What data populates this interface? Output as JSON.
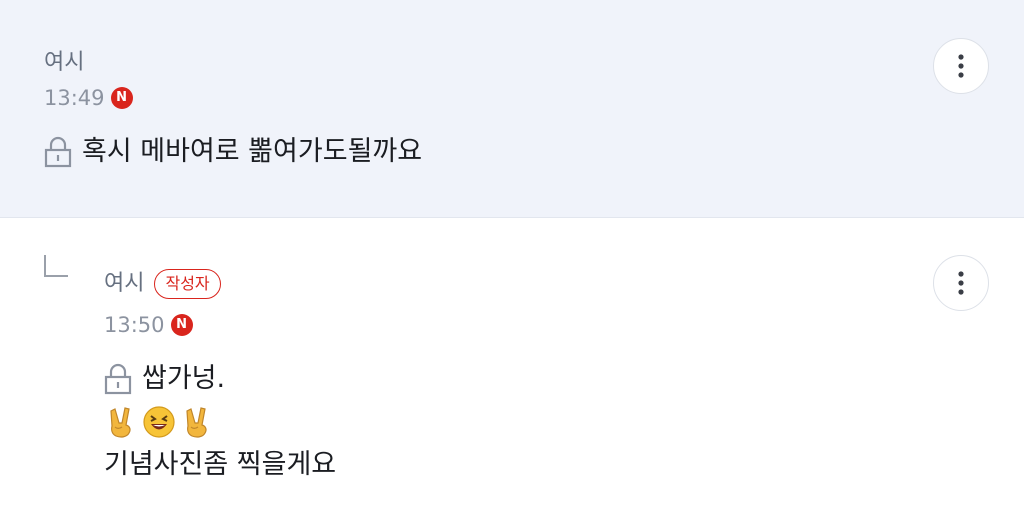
{
  "comments": [
    {
      "author": "여시",
      "time": "13:49",
      "badge": "N",
      "text": "혹시 메바여로 뽊여가도될까요"
    },
    {
      "author": "여시",
      "writer_label": "작성자",
      "time": "13:50",
      "badge": "N",
      "text_line1": "쌉가넝.",
      "emojis": [
        "victory-hand-icon",
        "laughing-face-icon",
        "victory-hand-icon"
      ],
      "text_line3": "기념사진좀 찍을게요"
    }
  ],
  "colors": {
    "badge_red": "#d9251d",
    "highlight_bg": "#f0f3fa"
  }
}
